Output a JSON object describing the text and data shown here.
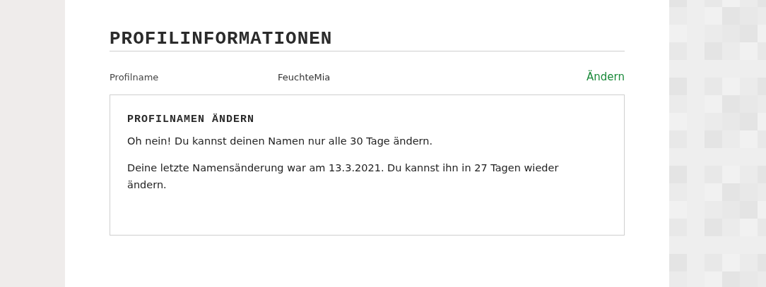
{
  "section": {
    "title": "PROFILINFORMATIONEN"
  },
  "profile_row": {
    "label": "Profilname",
    "value": "FeuchteMia",
    "action": "Ändern"
  },
  "dialog": {
    "title": "PROFILNAMEN ÄNDERN",
    "paragraphs": [
      "Oh nein! Du kannst deinen Namen nur alle 30 Tage ändern.",
      "Deine letzte Namensänderung war am 13.3.2021. Du kannst ihn in 27 Tagen wieder ändern."
    ]
  }
}
